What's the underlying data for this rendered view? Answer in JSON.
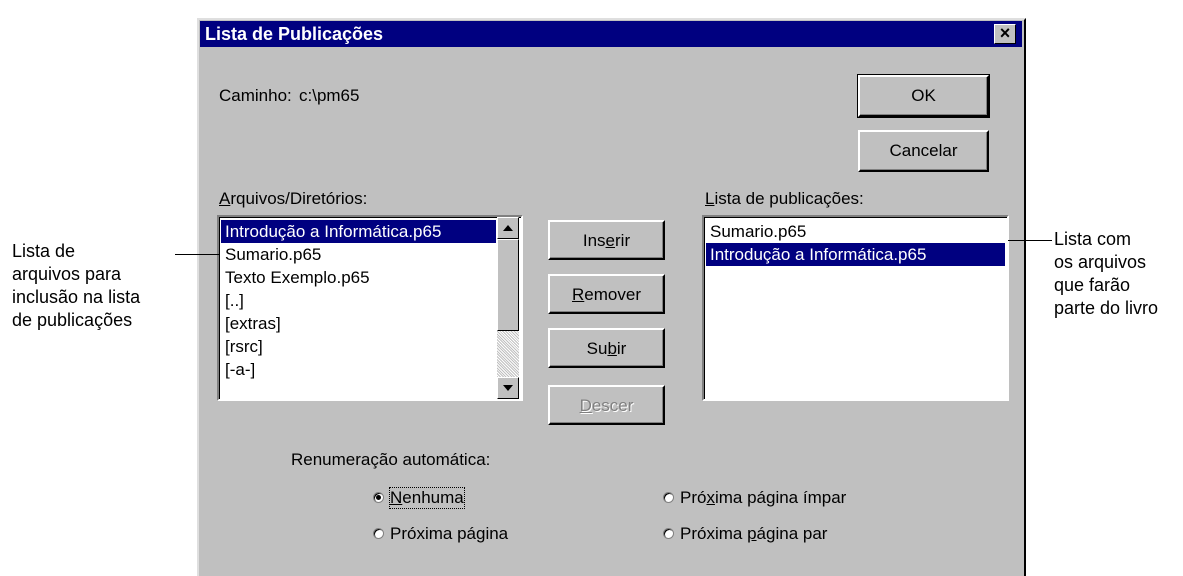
{
  "dialog": {
    "title": "Lista de Publicações",
    "close_label": "×"
  },
  "path": {
    "label": "Caminho:",
    "value": "c:\\pm65"
  },
  "buttons": {
    "ok": "OK",
    "cancel": "Cancelar",
    "insert": {
      "pre": "Ins",
      "u": "e",
      "post": "rir"
    },
    "remove": {
      "pre": "",
      "u": "R",
      "post": "emover"
    },
    "up": {
      "pre": "Su",
      "u": "b",
      "post": "ir"
    },
    "down": {
      "pre": "",
      "u": "D",
      "post": "escer"
    }
  },
  "files_list": {
    "label": {
      "u": "A",
      "post": "rquivos/Diretórios:"
    },
    "items": [
      "Introdução a Informática.p65",
      "Sumario.p65",
      "Texto Exemplo.p65",
      "[..]",
      "[extras]",
      "[rsrc]",
      "[-a-]"
    ],
    "selected_index": 0
  },
  "pub_list": {
    "label": {
      "u": "L",
      "post": "ista de publicações:"
    },
    "items": [
      "Sumario.p65",
      "Introdução a Informática.p65"
    ],
    "selected_index": 1
  },
  "renumber": {
    "label": "Renumeração automática:",
    "options": [
      {
        "pre": "",
        "u": "N",
        "post": "enhuma",
        "checked": true
      },
      {
        "pre": "Próxima pá",
        "u": "g",
        "post": "ina",
        "checked": false
      },
      {
        "pre": "Pró",
        "u": "x",
        "post": "ima página ímpar",
        "checked": false
      },
      {
        "pre": "Próxima ",
        "u": "p",
        "post": "ágina par",
        "checked": false
      }
    ]
  },
  "annotations": {
    "left": [
      "Lista de",
      "arquivos para",
      "inclusão na lista",
      "de publicações"
    ],
    "right": [
      "Lista com",
      "os arquivos",
      "que farão",
      "parte do livro"
    ]
  },
  "colors": {
    "titlebar": "#000080",
    "dialog_bg": "#c0c0c0",
    "selection": "#000080"
  },
  "icons": {
    "close": "close-icon",
    "scroll_up": "arrow-up-icon",
    "scroll_down": "arrow-down-icon"
  }
}
